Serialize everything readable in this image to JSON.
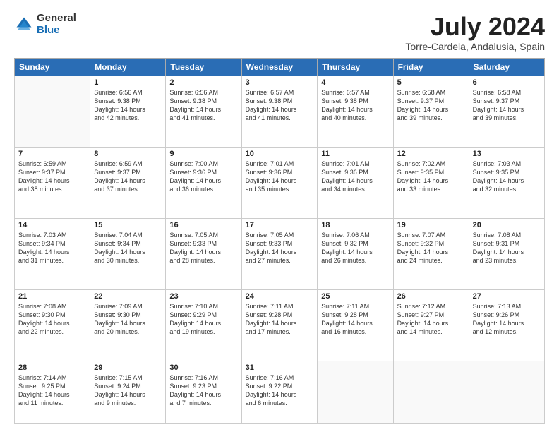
{
  "logo": {
    "general": "General",
    "blue": "Blue"
  },
  "title": "July 2024",
  "location": "Torre-Cardela, Andalusia, Spain",
  "weekdays": [
    "Sunday",
    "Monday",
    "Tuesday",
    "Wednesday",
    "Thursday",
    "Friday",
    "Saturday"
  ],
  "weeks": [
    [
      {
        "day": "",
        "content": ""
      },
      {
        "day": "1",
        "content": "Sunrise: 6:56 AM\nSunset: 9:38 PM\nDaylight: 14 hours\nand 42 minutes."
      },
      {
        "day": "2",
        "content": "Sunrise: 6:56 AM\nSunset: 9:38 PM\nDaylight: 14 hours\nand 41 minutes."
      },
      {
        "day": "3",
        "content": "Sunrise: 6:57 AM\nSunset: 9:38 PM\nDaylight: 14 hours\nand 41 minutes."
      },
      {
        "day": "4",
        "content": "Sunrise: 6:57 AM\nSunset: 9:38 PM\nDaylight: 14 hours\nand 40 minutes."
      },
      {
        "day": "5",
        "content": "Sunrise: 6:58 AM\nSunset: 9:37 PM\nDaylight: 14 hours\nand 39 minutes."
      },
      {
        "day": "6",
        "content": "Sunrise: 6:58 AM\nSunset: 9:37 PM\nDaylight: 14 hours\nand 39 minutes."
      }
    ],
    [
      {
        "day": "7",
        "content": "Sunrise: 6:59 AM\nSunset: 9:37 PM\nDaylight: 14 hours\nand 38 minutes."
      },
      {
        "day": "8",
        "content": "Sunrise: 6:59 AM\nSunset: 9:37 PM\nDaylight: 14 hours\nand 37 minutes."
      },
      {
        "day": "9",
        "content": "Sunrise: 7:00 AM\nSunset: 9:36 PM\nDaylight: 14 hours\nand 36 minutes."
      },
      {
        "day": "10",
        "content": "Sunrise: 7:01 AM\nSunset: 9:36 PM\nDaylight: 14 hours\nand 35 minutes."
      },
      {
        "day": "11",
        "content": "Sunrise: 7:01 AM\nSunset: 9:36 PM\nDaylight: 14 hours\nand 34 minutes."
      },
      {
        "day": "12",
        "content": "Sunrise: 7:02 AM\nSunset: 9:35 PM\nDaylight: 14 hours\nand 33 minutes."
      },
      {
        "day": "13",
        "content": "Sunrise: 7:03 AM\nSunset: 9:35 PM\nDaylight: 14 hours\nand 32 minutes."
      }
    ],
    [
      {
        "day": "14",
        "content": "Sunrise: 7:03 AM\nSunset: 9:34 PM\nDaylight: 14 hours\nand 31 minutes."
      },
      {
        "day": "15",
        "content": "Sunrise: 7:04 AM\nSunset: 9:34 PM\nDaylight: 14 hours\nand 30 minutes."
      },
      {
        "day": "16",
        "content": "Sunrise: 7:05 AM\nSunset: 9:33 PM\nDaylight: 14 hours\nand 28 minutes."
      },
      {
        "day": "17",
        "content": "Sunrise: 7:05 AM\nSunset: 9:33 PM\nDaylight: 14 hours\nand 27 minutes."
      },
      {
        "day": "18",
        "content": "Sunrise: 7:06 AM\nSunset: 9:32 PM\nDaylight: 14 hours\nand 26 minutes."
      },
      {
        "day": "19",
        "content": "Sunrise: 7:07 AM\nSunset: 9:32 PM\nDaylight: 14 hours\nand 24 minutes."
      },
      {
        "day": "20",
        "content": "Sunrise: 7:08 AM\nSunset: 9:31 PM\nDaylight: 14 hours\nand 23 minutes."
      }
    ],
    [
      {
        "day": "21",
        "content": "Sunrise: 7:08 AM\nSunset: 9:30 PM\nDaylight: 14 hours\nand 22 minutes."
      },
      {
        "day": "22",
        "content": "Sunrise: 7:09 AM\nSunset: 9:30 PM\nDaylight: 14 hours\nand 20 minutes."
      },
      {
        "day": "23",
        "content": "Sunrise: 7:10 AM\nSunset: 9:29 PM\nDaylight: 14 hours\nand 19 minutes."
      },
      {
        "day": "24",
        "content": "Sunrise: 7:11 AM\nSunset: 9:28 PM\nDaylight: 14 hours\nand 17 minutes."
      },
      {
        "day": "25",
        "content": "Sunrise: 7:11 AM\nSunset: 9:28 PM\nDaylight: 14 hours\nand 16 minutes."
      },
      {
        "day": "26",
        "content": "Sunrise: 7:12 AM\nSunset: 9:27 PM\nDaylight: 14 hours\nand 14 minutes."
      },
      {
        "day": "27",
        "content": "Sunrise: 7:13 AM\nSunset: 9:26 PM\nDaylight: 14 hours\nand 12 minutes."
      }
    ],
    [
      {
        "day": "28",
        "content": "Sunrise: 7:14 AM\nSunset: 9:25 PM\nDaylight: 14 hours\nand 11 minutes."
      },
      {
        "day": "29",
        "content": "Sunrise: 7:15 AM\nSunset: 9:24 PM\nDaylight: 14 hours\nand 9 minutes."
      },
      {
        "day": "30",
        "content": "Sunrise: 7:16 AM\nSunset: 9:23 PM\nDaylight: 14 hours\nand 7 minutes."
      },
      {
        "day": "31",
        "content": "Sunrise: 7:16 AM\nSunset: 9:22 PM\nDaylight: 14 hours\nand 6 minutes."
      },
      {
        "day": "",
        "content": ""
      },
      {
        "day": "",
        "content": ""
      },
      {
        "day": "",
        "content": ""
      }
    ]
  ]
}
